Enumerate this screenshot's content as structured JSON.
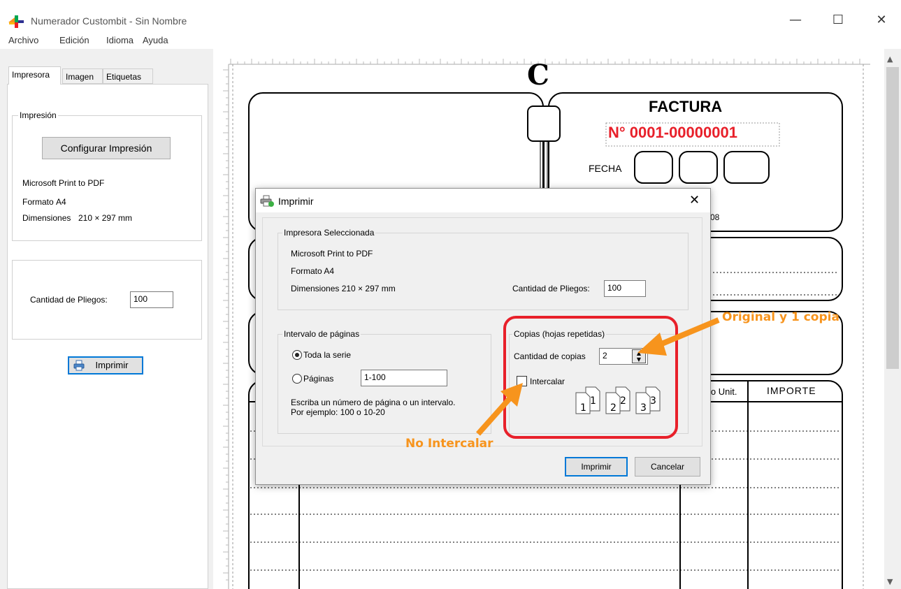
{
  "window": {
    "title": "Numerador Custombit - Sin Nombre",
    "minimize_glyph": "—",
    "maximize_glyph": "☐",
    "close_glyph": "✕"
  },
  "menu": {
    "items": [
      "Archivo",
      "Edición",
      "Idioma",
      "Ayuda"
    ]
  },
  "left_panel": {
    "tabs": [
      "Impresora",
      "Imagen",
      "Etiquetas"
    ],
    "impresion_group": {
      "label": "Impresión",
      "config_button": "Configurar Impresión",
      "printer": "Microsoft Print to PDF",
      "format_label": "Formato",
      "format_value": "A4",
      "dims_label": "Dimensiones",
      "dims_value": "210 × 297  mm"
    },
    "pliegos_label": "Cantidad de Pliegos:",
    "pliegos_value": "100",
    "print_button": "Imprimir"
  },
  "document": {
    "letter": "C",
    "title": "FACTURA",
    "number": "N° 0001-00000001",
    "fecha_label": "FECHA",
    "partial_code": "08",
    "col_precio": "io Unit.",
    "col_importe": "IMPORTE"
  },
  "dialog": {
    "title": "Imprimir",
    "close_glyph": "✕",
    "impresora_group": {
      "label": "Impresora Seleccionada",
      "printer": "Microsoft Print to PDF",
      "format": "Formato A4",
      "dims": "Dimensiones 210 × 297  mm",
      "pliegos_label": "Cantidad de Pliegos:",
      "pliegos_value": "100"
    },
    "intervalo_group": {
      "label": "Intervalo de páginas",
      "option_all": "Toda la serie",
      "option_pages": "Páginas",
      "pages_value": "1-100",
      "hint_line1": "Escriba un número de página o un intervalo.",
      "hint_line2": "Por ejemplo: 100 o 10-20",
      "selected": "all"
    },
    "copias_group": {
      "label": "Copias (hojas repetidas)",
      "copies_label": "Cantidad de copias",
      "copies_value": "2",
      "collate_label": "Intercalar",
      "collate_checked": false
    },
    "ok_button": "Imprimir",
    "cancel_button": "Cancelar"
  },
  "annotations": {
    "original": "Original y 1 copia",
    "no_collate": "No Intercalar",
    "accent_color": "#f7941d",
    "highlight_color": "#e8202a"
  }
}
